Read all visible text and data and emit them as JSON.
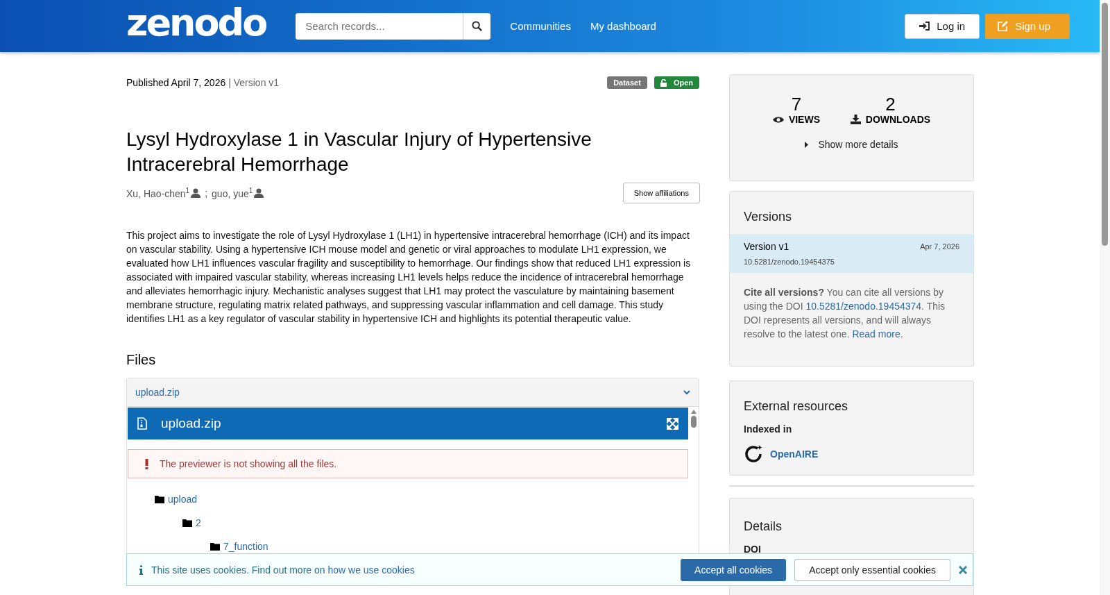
{
  "header": {
    "logo": "zenodo",
    "search": {
      "placeholder": "Search records..."
    },
    "nav": [
      "Communities",
      "My dashboard"
    ],
    "login": "Log in",
    "signup": "Sign up"
  },
  "record": {
    "published": "Published April 7, 2026",
    "version": "| Version v1",
    "badges": [
      {
        "label": "Dataset",
        "kind": "type"
      },
      {
        "label": "Open",
        "kind": "access"
      }
    ],
    "title": "Lysyl Hydroxylase 1 in Vascular Injury of Hypertensive Intracerebral Hemorrhage",
    "authors": [
      "Xu, Hao-chen$^{1}$",
      "guo, yue$^{1}$"
    ],
    "author_separator": ";",
    "affiliations_button": "Show affiliations",
    "description": "This project aims to investigate the role of Lysyl Hydroxylase 1 (LH1) in hypertensive intracerebral hemorrhage (ICH) and its impact on vascular stability. Using a hypertensive ICH mouse model and genetic or viral approaches to modulate LH1 expression, we evaluated how LH1 influences vascular fragility and susceptibility to hemorrhage. Our findings show that reduced LH1 expression is associated with impaired vascular stability, whereas increasing LH1 levels helps reduce the incidence of intracerebral hemorrhage and alleviates hemorrhagic injury. Mechanistic analyses suggest that LH1 may protect the vasculature by maintaining basement membrane structure, regulating matrix related pathways, and suppressing vascular inflammation and cell damage. This study identifies LH1 as a key regulator of vascular stability in hypertensive ICH and highlights its potential therapeutic value."
  },
  "files": {
    "heading": "Files",
    "accordion_title": "upload.zip",
    "preview_title": "upload.zip",
    "alert": "The previewer is not showing all the files.",
    "tree": [
      {
        "name": "upload",
        "children": [
          {
            "name": "2",
            "children": [
              {
                "name": "7_function"
              }
            ]
          }
        ]
      }
    ]
  },
  "stats": {
    "views": "7",
    "views_label": "VIEWS",
    "downloads": "2",
    "downloads_label": "DOWNLOADS",
    "more": "Show more details"
  },
  "versions": {
    "heading": "Versions",
    "items": [
      {
        "label": "Version v1",
        "date": "Apr 7, 2026",
        "doi": "10.5281/zenodo.19454375",
        "selected": true
      }
    ],
    "cite_lead": "Cite all versions?",
    "cite_text1": "You can cite all versions by using the DOI",
    "cite_doi": "10.5281/zenodo.19454374",
    "cite_text2": ". This DOI represents all versions, and will always resolve to the latest one.",
    "read_more": "Read more",
    "cite_end": "."
  },
  "external": {
    "heading": "External resources",
    "indexed_label": "Indexed in",
    "links": [
      "OpenAIRE"
    ]
  },
  "details": {
    "heading": "Details",
    "fields": [
      "DOI"
    ]
  },
  "cookies": {
    "text": "This site uses cookies. Find out more on",
    "link": "how we use cookies",
    "accept_all": "Accept all cookies",
    "accept_essential": "Accept only essential cookies"
  }
}
